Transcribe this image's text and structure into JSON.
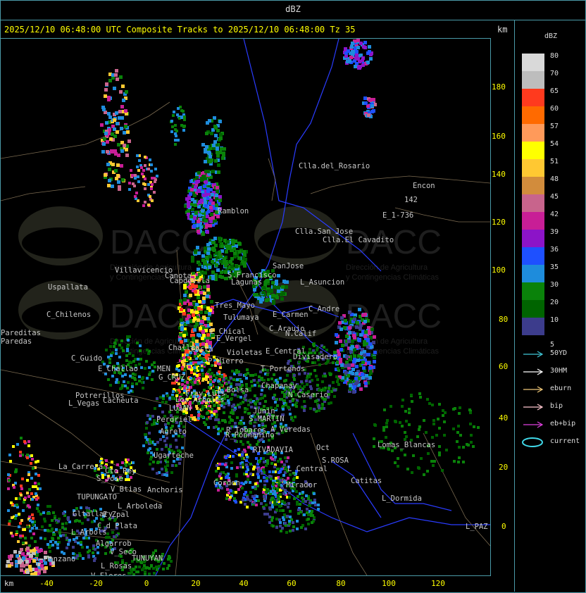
{
  "header": {
    "title": "dBZ"
  },
  "subtitle": "2025/12/10 06:48:00 UTC Composite Tracks to 2025/12/10 06:48:00 Tz 35",
  "km_top": "km",
  "km_bottom": "km",
  "y_ticks": [
    "180",
    "160",
    "140",
    "120",
    "100",
    "80",
    "60",
    "40",
    "20",
    "0"
  ],
  "x_ticks": [
    "-40",
    "-20",
    "0",
    "20",
    "40",
    "60",
    "80",
    "100",
    "120"
  ],
  "legend": {
    "title": "dBZ",
    "colors": [
      {
        "label": "80",
        "color": "#d9d9d9"
      },
      {
        "label": "70",
        "color": "#bdbdbd"
      },
      {
        "label": "65",
        "color": "#ff3a1e"
      },
      {
        "label": "60",
        "color": "#ff6a00"
      },
      {
        "label": "57",
        "color": "#ff9a5a"
      },
      {
        "label": "54",
        "color": "#ffff00"
      },
      {
        "label": "51",
        "color": "#ffc832"
      },
      {
        "label": "48",
        "color": "#d28c3c"
      },
      {
        "label": "45",
        "color": "#c8648c"
      },
      {
        "label": "42",
        "color": "#c81e96"
      },
      {
        "label": "39",
        "color": "#8c14c8"
      },
      {
        "label": "36",
        "color": "#1e50ff"
      },
      {
        "label": "35",
        "color": "#1e8cdc"
      },
      {
        "label": "30",
        "color": "#0a820a"
      },
      {
        "label": "20",
        "color": "#006400"
      },
      {
        "label": "10",
        "color": "#3c3c8c"
      },
      {
        "label": "5",
        "color": "#000000"
      }
    ],
    "tracks": [
      {
        "label": "50YD",
        "color": "#40c8d8",
        "icon": "arrow"
      },
      {
        "label": "30HM",
        "color": "#ffffff",
        "icon": "arrow"
      },
      {
        "label": "eburn",
        "color": "#f0c878",
        "icon": "arrow"
      },
      {
        "label": "bip",
        "color": "#ffc8d0",
        "icon": "arrow"
      },
      {
        "label": "eb+bip",
        "color": "#e040e0",
        "icon": "arrow"
      },
      {
        "label": "current",
        "color": "#40d8e8",
        "icon": "ellipse"
      }
    ]
  },
  "watermark": {
    "text": "DACC",
    "sub1": "Dirección de Agricultura",
    "sub2": "y Contingencias Climáticas"
  },
  "places": [
    {
      "name": "Clla.del_Rosario"
    },
    {
      "name": "Encon"
    },
    {
      "name": "142"
    },
    {
      "name": "E_1-736"
    },
    {
      "name": "Ramblon"
    },
    {
      "name": "Clla.San Jose"
    },
    {
      "name": "Clla.El Cavadito"
    },
    {
      "name": "Villavicencio"
    },
    {
      "name": "Uspallata"
    },
    {
      "name": "Canota"
    },
    {
      "name": "Capdevila"
    },
    {
      "name": "S.Francisco"
    },
    {
      "name": "Lagunas"
    },
    {
      "name": "SanJose"
    },
    {
      "name": "L_Asuncion"
    },
    {
      "name": "C_Chilenos"
    },
    {
      "name": "Tres_Mayo"
    },
    {
      "name": "Tulumaya"
    },
    {
      "name": "C_Andre"
    },
    {
      "name": "E_Carmen"
    },
    {
      "name": "Paredas"
    },
    {
      "name": "E_Chical"
    },
    {
      "name": "E_Vergel"
    },
    {
      "name": "C_Araujo"
    },
    {
      "name": "N.Calif"
    },
    {
      "name": "Costa"
    },
    {
      "name": "Challao"
    },
    {
      "name": "Violetas"
    },
    {
      "name": "E_Central"
    },
    {
      "name": "P_Hierro"
    },
    {
      "name": "Divisadero"
    },
    {
      "name": "C_Guido"
    },
    {
      "name": "E_Challao"
    },
    {
      "name": "MEN"
    },
    {
      "name": "G_CRUZ"
    },
    {
      "name": "T_Portenos"
    },
    {
      "name": "L_Bolsa"
    },
    {
      "name": "Chapanay"
    },
    {
      "name": "Potrerillos"
    },
    {
      "name": "Cacheuta"
    },
    {
      "name": "Fray Luis"
    },
    {
      "name": "Los Arboles"
    },
    {
      "name": "N_Caserio"
    },
    {
      "name": "L_Vegas"
    },
    {
      "name": "LUJAN"
    },
    {
      "name": "Perdriel"
    },
    {
      "name": "Junin"
    },
    {
      "name": "S_MARTIN"
    },
    {
      "name": "Agrelo"
    },
    {
      "name": "R_Tobares"
    },
    {
      "name": "A_Veredas"
    },
    {
      "name": "R_Ponnanino"
    },
    {
      "name": "Ugarteche"
    },
    {
      "name": "RIVADAVIA"
    },
    {
      "name": "S.ROSA"
    },
    {
      "name": "Oct"
    },
    {
      "name": "Lomas_Blancas"
    },
    {
      "name": "La_Carrera"
    },
    {
      "name": "Cto_Rey"
    },
    {
      "name": "S_Jose"
    },
    {
      "name": "L_Central"
    },
    {
      "name": "Catitas"
    },
    {
      "name": "Anchoris"
    },
    {
      "name": "Cordon"
    },
    {
      "name": "Mirador"
    },
    {
      "name": "TUPUNGATO"
    },
    {
      "name": "V_Btias"
    },
    {
      "name": "L_Arboleda"
    },
    {
      "name": "L_Dormida"
    },
    {
      "name": "Gltallary"
    },
    {
      "name": "E_Zpal"
    },
    {
      "name": "C_d_Plata"
    },
    {
      "name": "L_Arbols"
    },
    {
      "name": "Algarrob"
    },
    {
      "name": "V_Seco"
    },
    {
      "name": "TUNUYAN"
    },
    {
      "name": "Manzano"
    },
    {
      "name": "L_Rosas"
    },
    {
      "name": "V_Flores"
    },
    {
      "name": "L_PAZ"
    },
    {
      "name": "Pareditas"
    }
  ]
}
